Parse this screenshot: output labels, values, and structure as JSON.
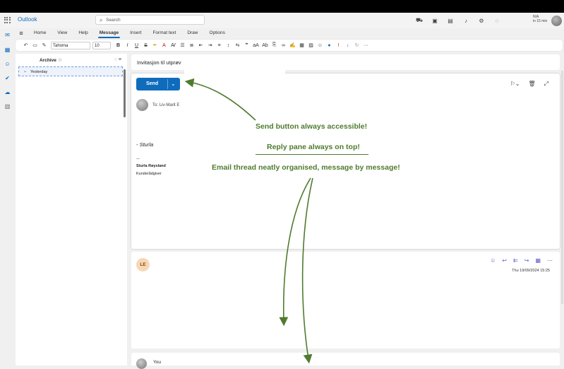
{
  "app": {
    "name": "Outlook",
    "search_placeholder": "Search"
  },
  "status": {
    "line1": "N/A",
    "line2": "in 15 min"
  },
  "nav": {
    "tabs": [
      "Home",
      "View",
      "Help",
      "Message",
      "Insert",
      "Format text",
      "Draw",
      "Options"
    ],
    "active": "Message"
  },
  "ribbon": {
    "font_name": "Tahoma",
    "font_size": "10"
  },
  "folder": {
    "title": "Archive",
    "group": "Yesterday"
  },
  "message": {
    "subject": "Invitasjon til utprøv",
    "send_label": "Send",
    "to_prefix": "To:",
    "to_name": "Liv-Marit E",
    "sig_name_line": "- Sturla",
    "sig_divider": "—",
    "sig_full_name": "Sturla Røysland",
    "sig_title": "Kunderådgiver"
  },
  "thread": {
    "sender_initials": "LE",
    "date": "Thu 19/09/2024 15:25",
    "next_sender": "You"
  },
  "annotations": {
    "a1": "Send button always accessible!",
    "a2": "Reply pane always on top!",
    "a3": "Email thread neatly organised, message by message!"
  },
  "colors": {
    "accent": "#0f6cbd",
    "annotation": "#4f7b2f",
    "avatar_le": "#f8d7b5"
  }
}
